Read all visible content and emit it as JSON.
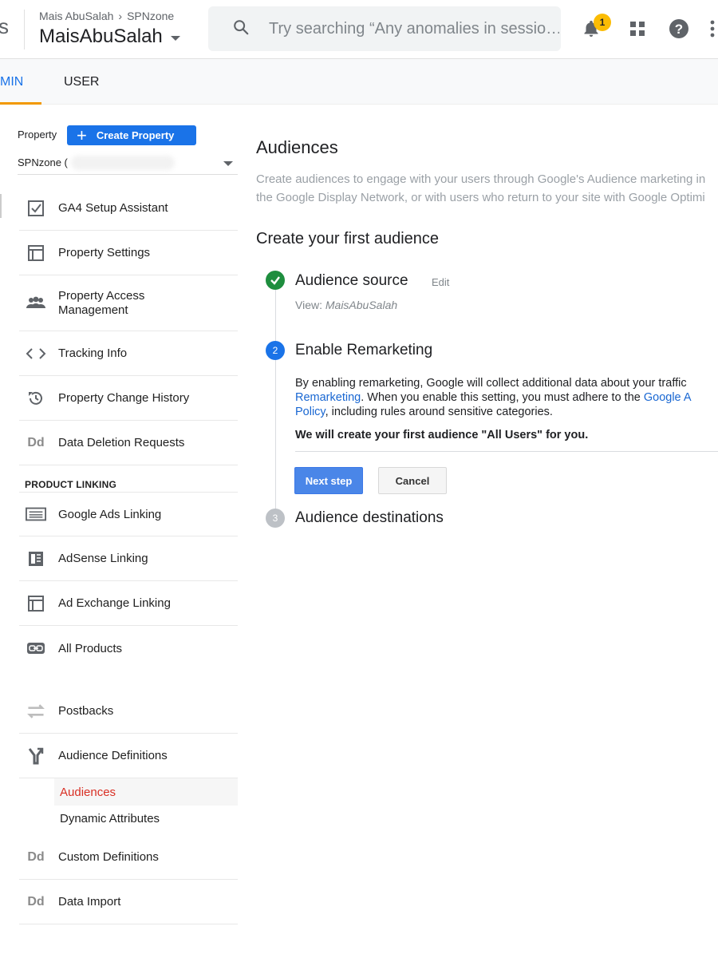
{
  "app": {
    "title_edge": "s"
  },
  "header": {
    "breadcrumb": [
      "Mais AbuSalah",
      "SPNzone"
    ],
    "account_name": "MaisAbuSalah",
    "search_placeholder": "Try searching “Any anomalies in sessio…",
    "notification_count": "1",
    "icons": [
      "search-icon",
      "bell-icon",
      "apps-grid-icon",
      "help-icon",
      "more-vert-icon"
    ]
  },
  "tabs": [
    {
      "label": "MIN",
      "full_label": "ADMIN",
      "active": true
    },
    {
      "label": "USER",
      "active": false
    }
  ],
  "sidebar": {
    "property_label": "Property",
    "create_property_label": "Create Property",
    "property_select_value": "SPNzone (",
    "items": [
      {
        "label": "GA4 Setup Assistant",
        "icon": "checkbox-icon"
      },
      {
        "label": "Property Settings",
        "icon": "layout-icon"
      },
      {
        "label": "Property Access Management",
        "icon": "people-icon"
      },
      {
        "label": "Tracking Info",
        "icon": "code-icon"
      },
      {
        "label": "Property Change History",
        "icon": "history-icon"
      },
      {
        "label": "Data Deletion Requests",
        "icon": "dd-icon"
      }
    ],
    "section_heading": "PRODUCT LINKING",
    "linking_items": [
      {
        "label": "Google Ads Linking",
        "icon": "ads-icon"
      },
      {
        "label": "AdSense Linking",
        "icon": "adsense-icon"
      },
      {
        "label": "Ad Exchange Linking",
        "icon": "ad-exchange-icon"
      },
      {
        "label": "All Products",
        "icon": "link-icon"
      }
    ],
    "other_items": [
      {
        "label": "Postbacks",
        "icon": "postbacks-icon"
      },
      {
        "label": "Audience Definitions",
        "icon": "audience-fork-icon"
      }
    ],
    "sub_items": [
      {
        "label": "Audiences",
        "active": true
      },
      {
        "label": "Dynamic Attributes",
        "active": false
      }
    ],
    "bottom_items": [
      {
        "label": "Custom Definitions",
        "icon": "dd-icon"
      },
      {
        "label": "Data Import",
        "icon": "dd-icon"
      }
    ]
  },
  "main": {
    "title": "Audiences",
    "description_line1": "Create audiences to engage with your users through Google's Audience marketing in",
    "description_line2": "the Google Display Network, or with users who return to your site with Google Optimi",
    "subtitle": "Create your first audience",
    "steps": [
      {
        "number": "✓",
        "title": "Audience source",
        "status": "complete"
      },
      {
        "number": "2",
        "title": "Enable Remarketing",
        "status": "active"
      },
      {
        "number": "3",
        "title": "Audience destinations",
        "status": "pending"
      }
    ],
    "edit_label": "Edit",
    "view_prefix": "View: ",
    "view_value": "MaisAbuSalah",
    "remarketing_line1": "By enabling remarketing, Google will collect additional data about your traffic",
    "remarketing_link1": "Remarketing",
    "remarketing_line2_rest": ". When you enable this setting, you must adhere to the ",
    "remarketing_link2a": "Google A",
    "remarketing_link2b": "Policy",
    "remarketing_line3_rest": ", including rules around sensitive categories.",
    "bold_note": "We will create your first audience \"All Users\" for you.",
    "next_button": "Next step",
    "cancel_button": "Cancel"
  },
  "colors": {
    "accent_blue": "#1a73e8",
    "tab_underline": "#f29900",
    "step_complete": "#1e8e3e",
    "step_active": "#1a73e8",
    "step_pending": "#bdc1c6",
    "active_sub_item": "#d93025",
    "badge": "#fbbc04"
  }
}
